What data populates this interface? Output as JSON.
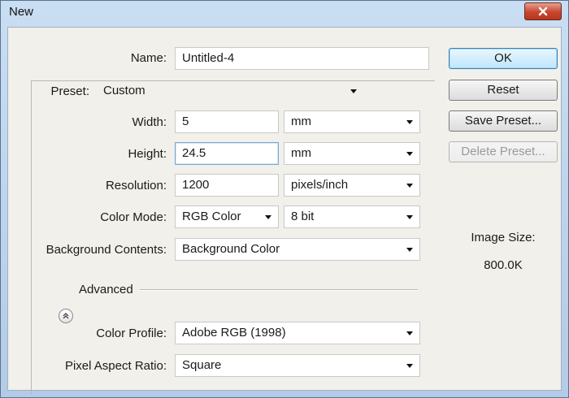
{
  "window": {
    "title": "New"
  },
  "form": {
    "name": {
      "label": "Name:",
      "value": "Untitled-4"
    },
    "preset": {
      "label": "Preset:",
      "value": "Custom"
    },
    "width": {
      "label": "Width:",
      "value": "5",
      "unit": "mm"
    },
    "height": {
      "label": "Height:",
      "value": "24.5",
      "unit": "mm"
    },
    "resolution": {
      "label": "Resolution:",
      "value": "1200",
      "unit": "pixels/inch"
    },
    "color_mode": {
      "label": "Color Mode:",
      "value": "RGB Color",
      "depth": "8 bit"
    },
    "background": {
      "label": "Background Contents:",
      "value": "Background Color"
    },
    "advanced": {
      "label": "Advanced"
    },
    "color_profile": {
      "label": "Color Profile:",
      "value": "Adobe RGB (1998)"
    },
    "pixel_aspect": {
      "label": "Pixel Aspect Ratio:",
      "value": "Square"
    }
  },
  "buttons": {
    "ok": "OK",
    "reset": "Reset",
    "save_preset": "Save Preset...",
    "delete_preset": "Delete Preset..."
  },
  "image_size": {
    "label": "Image Size:",
    "value": "800.0K"
  },
  "icons": [
    "close-icon",
    "dropdown-arrow-icon",
    "collapse-chevron-icon"
  ]
}
